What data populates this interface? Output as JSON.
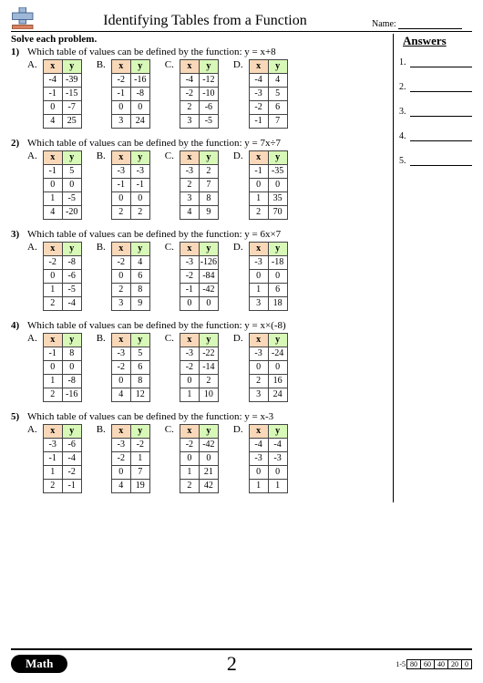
{
  "header": {
    "title": "Identifying Tables from a Function",
    "name_label": "Name:"
  },
  "instruction": "Solve each problem.",
  "answers": {
    "title": "Answers",
    "rows": [
      "1.",
      "2.",
      "3.",
      "4.",
      "5."
    ]
  },
  "problems": [
    {
      "num": "1)",
      "prompt": "Which table of values can be defined by the function: y = x+8",
      "options": [
        {
          "label": "A.",
          "x": "x",
          "y": "y",
          "rows": [
            [
              "-4",
              "-39"
            ],
            [
              "-1",
              "-15"
            ],
            [
              "0",
              "-7"
            ],
            [
              "4",
              "25"
            ]
          ]
        },
        {
          "label": "B.",
          "x": "x",
          "y": "y",
          "rows": [
            [
              "-2",
              "-16"
            ],
            [
              "-1",
              "-8"
            ],
            [
              "0",
              "0"
            ],
            [
              "3",
              "24"
            ]
          ]
        },
        {
          "label": "C.",
          "x": "x",
          "y": "y",
          "rows": [
            [
              "-4",
              "-12"
            ],
            [
              "-2",
              "-10"
            ],
            [
              "2",
              "-6"
            ],
            [
              "3",
              "-5"
            ]
          ]
        },
        {
          "label": "D.",
          "x": "x",
          "y": "y",
          "rows": [
            [
              "-4",
              "4"
            ],
            [
              "-3",
              "5"
            ],
            [
              "-2",
              "6"
            ],
            [
              "-1",
              "7"
            ]
          ]
        }
      ]
    },
    {
      "num": "2)",
      "prompt": "Which table of values can be defined by the function: y = 7x÷7",
      "options": [
        {
          "label": "A.",
          "x": "x",
          "y": "y",
          "rows": [
            [
              "-1",
              "5"
            ],
            [
              "0",
              "0"
            ],
            [
              "1",
              "-5"
            ],
            [
              "4",
              "-20"
            ]
          ]
        },
        {
          "label": "B.",
          "x": "x",
          "y": "y",
          "rows": [
            [
              "-3",
              "-3"
            ],
            [
              "-1",
              "-1"
            ],
            [
              "0",
              "0"
            ],
            [
              "2",
              "2"
            ]
          ]
        },
        {
          "label": "C.",
          "x": "x",
          "y": "y",
          "rows": [
            [
              "-3",
              "2"
            ],
            [
              "2",
              "7"
            ],
            [
              "3",
              "8"
            ],
            [
              "4",
              "9"
            ]
          ]
        },
        {
          "label": "D.",
          "x": "x",
          "y": "y",
          "rows": [
            [
              "-1",
              "-35"
            ],
            [
              "0",
              "0"
            ],
            [
              "1",
              "35"
            ],
            [
              "2",
              "70"
            ]
          ]
        }
      ]
    },
    {
      "num": "3)",
      "prompt": "Which table of values can be defined by the function: y = 6x×7",
      "options": [
        {
          "label": "A.",
          "x": "x",
          "y": "y",
          "rows": [
            [
              "-2",
              "-8"
            ],
            [
              "0",
              "-6"
            ],
            [
              "1",
              "-5"
            ],
            [
              "2",
              "-4"
            ]
          ]
        },
        {
          "label": "B.",
          "x": "x",
          "y": "y",
          "rows": [
            [
              "-2",
              "4"
            ],
            [
              "0",
              "6"
            ],
            [
              "2",
              "8"
            ],
            [
              "3",
              "9"
            ]
          ]
        },
        {
          "label": "C.",
          "x": "x",
          "y": "y",
          "rows": [
            [
              "-3",
              "-126"
            ],
            [
              "-2",
              "-84"
            ],
            [
              "-1",
              "-42"
            ],
            [
              "0",
              "0"
            ]
          ]
        },
        {
          "label": "D.",
          "x": "x",
          "y": "y",
          "rows": [
            [
              "-3",
              "-18"
            ],
            [
              "0",
              "0"
            ],
            [
              "1",
              "6"
            ],
            [
              "3",
              "18"
            ]
          ]
        }
      ]
    },
    {
      "num": "4)",
      "prompt": "Which table of values can be defined by the function: y = x×(-8)",
      "options": [
        {
          "label": "A.",
          "x": "x",
          "y": "y",
          "rows": [
            [
              "-1",
              "8"
            ],
            [
              "0",
              "0"
            ],
            [
              "1",
              "-8"
            ],
            [
              "2",
              "-16"
            ]
          ]
        },
        {
          "label": "B.",
          "x": "x",
          "y": "y",
          "rows": [
            [
              "-3",
              "5"
            ],
            [
              "-2",
              "6"
            ],
            [
              "0",
              "8"
            ],
            [
              "4",
              "12"
            ]
          ]
        },
        {
          "label": "C.",
          "x": "x",
          "y": "y",
          "rows": [
            [
              "-3",
              "-22"
            ],
            [
              "-2",
              "-14"
            ],
            [
              "0",
              "2"
            ],
            [
              "1",
              "10"
            ]
          ]
        },
        {
          "label": "D.",
          "x": "x",
          "y": "y",
          "rows": [
            [
              "-3",
              "-24"
            ],
            [
              "0",
              "0"
            ],
            [
              "2",
              "16"
            ],
            [
              "3",
              "24"
            ]
          ]
        }
      ]
    },
    {
      "num": "5)",
      "prompt": "Which table of values can be defined by the function: y = x-3",
      "options": [
        {
          "label": "A.",
          "x": "x",
          "y": "y",
          "rows": [
            [
              "-3",
              "-6"
            ],
            [
              "-1",
              "-4"
            ],
            [
              "1",
              "-2"
            ],
            [
              "2",
              "-1"
            ]
          ]
        },
        {
          "label": "B.",
          "x": "x",
          "y": "y",
          "rows": [
            [
              "-3",
              "-2"
            ],
            [
              "-2",
              "1"
            ],
            [
              "0",
              "7"
            ],
            [
              "4",
              "19"
            ]
          ]
        },
        {
          "label": "C.",
          "x": "x",
          "y": "y",
          "rows": [
            [
              "-2",
              "-42"
            ],
            [
              "0",
              "0"
            ],
            [
              "1",
              "21"
            ],
            [
              "2",
              "42"
            ]
          ]
        },
        {
          "label": "D.",
          "x": "x",
          "y": "y",
          "rows": [
            [
              "-4",
              "-4"
            ],
            [
              "-3",
              "-3"
            ],
            [
              "0",
              "0"
            ],
            [
              "1",
              "1"
            ]
          ]
        }
      ]
    }
  ],
  "footer": {
    "brand": "Math",
    "page": "2",
    "score_label": "1-5",
    "score_cells": [
      "80",
      "60",
      "40",
      "20",
      "0"
    ]
  }
}
